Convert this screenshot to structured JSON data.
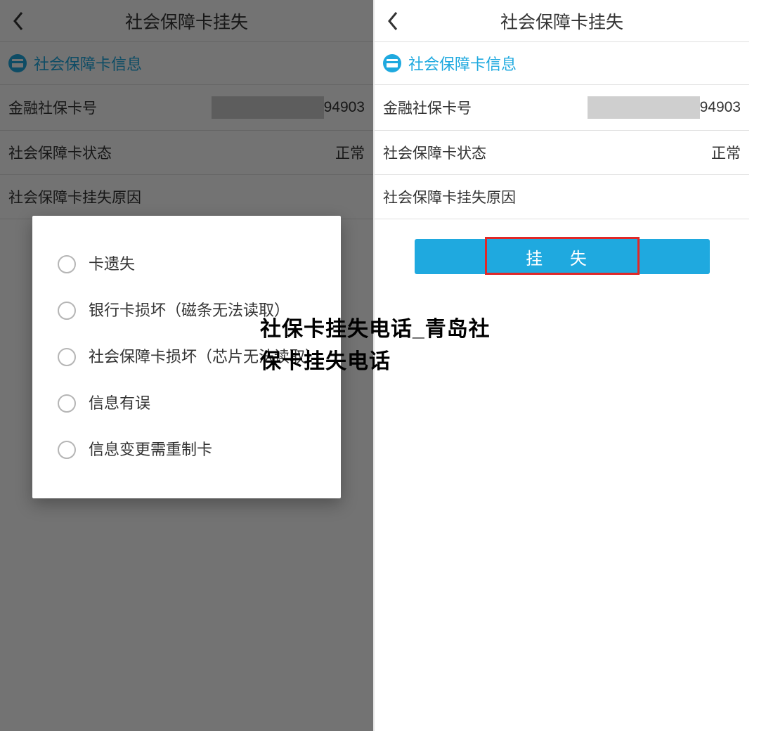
{
  "header": {
    "title": "社会保障卡挂失"
  },
  "info_section": {
    "label": "社会保障卡信息"
  },
  "fields": {
    "card_number": {
      "label": "金融社保卡号",
      "tail": "94903"
    },
    "status": {
      "label": "社会保障卡状态",
      "value": "正常"
    },
    "reason": {
      "label": "社会保障卡挂失原因"
    }
  },
  "reason_options": [
    "卡遗失",
    "银行卡损坏（磁条无法读取）",
    "社会保障卡损坏（芯片无法读取）",
    "信息有误",
    "信息变更需重制卡"
  ],
  "submit_label": "挂 失",
  "overlay_caption": "社保卡挂失电话_青岛社保卡挂失电话"
}
